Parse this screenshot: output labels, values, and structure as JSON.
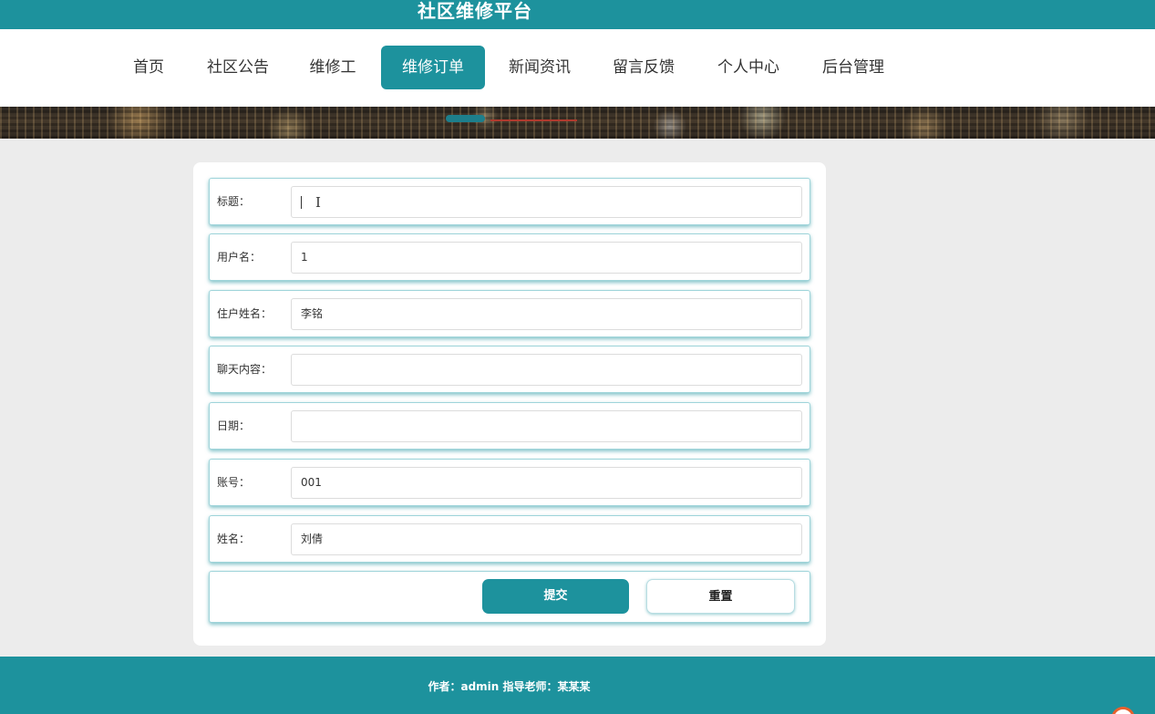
{
  "header": {
    "site_title": "社区维修平台"
  },
  "nav": {
    "items": [
      {
        "label": "首页"
      },
      {
        "label": "社区公告"
      },
      {
        "label": "维修工"
      },
      {
        "label": "维修订单",
        "active": true
      },
      {
        "label": "新闻资讯"
      },
      {
        "label": "留言反馈"
      },
      {
        "label": "个人中心"
      },
      {
        "label": "后台管理"
      }
    ]
  },
  "form": {
    "fields": [
      {
        "label": "标题：",
        "value": ""
      },
      {
        "label": "用户名：",
        "value": "1"
      },
      {
        "label": "住户姓名：",
        "value": "李铭"
      },
      {
        "label": "聊天内容：",
        "value": ""
      },
      {
        "label": "日期：",
        "value": ""
      },
      {
        "label": "账号：",
        "value": "001"
      },
      {
        "label": "姓名：",
        "value": "刘倩"
      }
    ],
    "submit_label": "提交",
    "reset_label": "重置"
  },
  "footer": {
    "text": "作者：admin 指导老师：某某某"
  },
  "colors": {
    "primary": "#1d929d",
    "page_bg": "#ececec"
  }
}
